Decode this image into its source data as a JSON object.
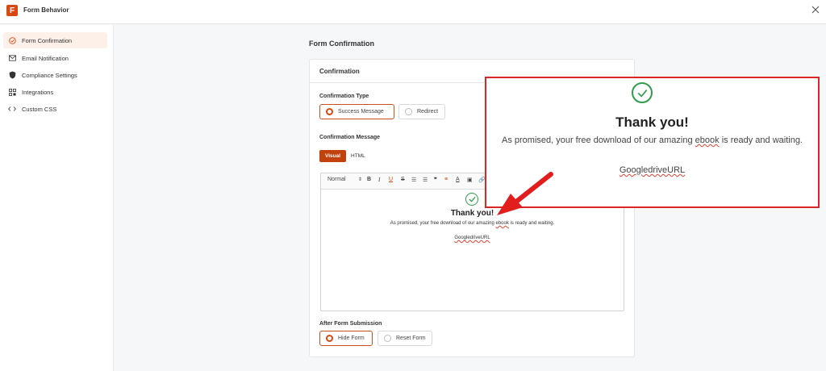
{
  "app": {
    "title": "Form Behavior",
    "logo_letter": "F"
  },
  "sidebar": {
    "items": [
      {
        "label": "Form Confirmation",
        "icon": "check-circle-icon",
        "active": true
      },
      {
        "label": "Email Notification",
        "icon": "envelope-icon",
        "active": false
      },
      {
        "label": "Compliance Settings",
        "icon": "shield-icon",
        "active": false
      },
      {
        "label": "Integrations",
        "icon": "grid-icon",
        "active": false
      },
      {
        "label": "Custom CSS",
        "icon": "code-icon",
        "active": false
      }
    ]
  },
  "main": {
    "section_title": "Form Confirmation",
    "card_title": "Confirmation",
    "confirmation_type": {
      "label": "Confirmation Type",
      "options": [
        "Success Message",
        "Redirect"
      ],
      "selected": "Success Message"
    },
    "confirmation_message": {
      "label": "Confirmation Message",
      "tabs": [
        "Visual",
        "HTML"
      ],
      "active_tab": "Visual"
    },
    "toolbar": {
      "format": "Normal",
      "buttons": [
        "B",
        "I",
        "U",
        "S",
        "ol",
        "ul",
        "❞",
        "strike",
        "A",
        "img",
        "link"
      ]
    },
    "editor_content": {
      "heading": "Thank you!",
      "body": "As promised, your free download of our amazing ",
      "misspelled": "ebook",
      "body_end": " is ready and waiting.",
      "link": "GoogledriveURL"
    },
    "after_submission": {
      "label": "After Form Submission",
      "options": [
        "Hide Form",
        "Reset Form"
      ],
      "selected": "Hide Form"
    }
  },
  "callout": {
    "heading": "Thank you!",
    "body": "As promised, your free download of our amazing ",
    "misspelled": "ebook",
    "body_end": " is ready and waiting.",
    "link": "GoogledriveURL"
  },
  "colors": {
    "accent": "#c2410c",
    "success": "#2e9e4b",
    "callout_border": "#dc2626"
  }
}
